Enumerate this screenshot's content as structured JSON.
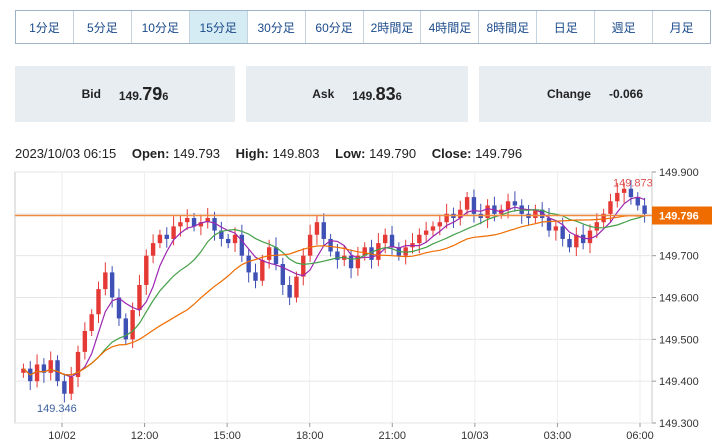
{
  "timeframes": [
    {
      "label": "1分足",
      "active": false
    },
    {
      "label": "5分足",
      "active": false
    },
    {
      "label": "10分足",
      "active": false
    },
    {
      "label": "15分足",
      "active": true
    },
    {
      "label": "30分足",
      "active": false
    },
    {
      "label": "60分足",
      "active": false
    },
    {
      "label": "2時間足",
      "active": false
    },
    {
      "label": "4時間足",
      "active": false
    },
    {
      "label": "8時間足",
      "active": false
    },
    {
      "label": "日足",
      "active": false
    },
    {
      "label": "週足",
      "active": false
    },
    {
      "label": "月足",
      "active": false
    }
  ],
  "quote": {
    "bid_label": "Bid",
    "bid_prefix": "149.",
    "bid_big": "79",
    "bid_small": "6",
    "ask_label": "Ask",
    "ask_prefix": "149.",
    "ask_big": "83",
    "ask_small": "6",
    "change_label": "Change",
    "change_value": "-0.066"
  },
  "ohlc": {
    "datetime": "2023/10/03 06:15",
    "open_label": "Open:",
    "open": "149.793",
    "high_label": "High:",
    "high": "149.803",
    "low_label": "Low:",
    "low": "149.790",
    "close_label": "Close:",
    "close": "149.796"
  },
  "chart_data": {
    "type": "candlestick",
    "y_ticks": [
      "149.900",
      "149.800",
      "149.700",
      "149.600",
      "149.500",
      "149.400",
      "149.300"
    ],
    "ylim": [
      149.3,
      149.9
    ],
    "x_ticks": [
      "10/02",
      "12:00",
      "15:00",
      "18:00",
      "21:00",
      "10/03",
      "03:00",
      "06:00"
    ],
    "current_price_label": "149.796",
    "current_price": 149.796,
    "high_marker": "149.873",
    "low_marker": "149.346",
    "colors": {
      "up": "#e53935",
      "down": "#3f51b5",
      "ma_fast": "#9c27b0",
      "ma_mid": "#43a047",
      "ma_slow": "#ef6c00",
      "price_line": "#f08a3c",
      "price_box": "#ef6c00"
    },
    "close_series": [
      149.43,
      149.4,
      149.44,
      149.42,
      149.45,
      149.4,
      149.37,
      149.41,
      149.47,
      149.52,
      149.56,
      149.62,
      149.66,
      149.6,
      149.55,
      149.5,
      149.57,
      149.63,
      149.7,
      149.73,
      149.75,
      149.74,
      149.77,
      149.78,
      149.79,
      149.77,
      149.78,
      149.79,
      149.76,
      149.74,
      149.73,
      149.75,
      149.7,
      149.66,
      149.64,
      149.69,
      149.72,
      149.68,
      149.63,
      149.6,
      149.65,
      149.7,
      149.75,
      149.78,
      149.74,
      149.71,
      149.69,
      149.7,
      149.67,
      149.7,
      149.72,
      149.69,
      149.73,
      149.75,
      149.72,
      149.7,
      149.72,
      149.73,
      149.75,
      149.76,
      149.77,
      149.78,
      149.8,
      149.79,
      149.81,
      149.84,
      149.8,
      149.79,
      149.82,
      149.8,
      149.81,
      149.83,
      149.82,
      149.8,
      149.79,
      149.81,
      149.79,
      149.76,
      149.77,
      149.74,
      149.72,
      149.75,
      149.73,
      149.76,
      149.78,
      149.8,
      149.83,
      149.85,
      149.86,
      149.84,
      149.82,
      149.8
    ]
  }
}
